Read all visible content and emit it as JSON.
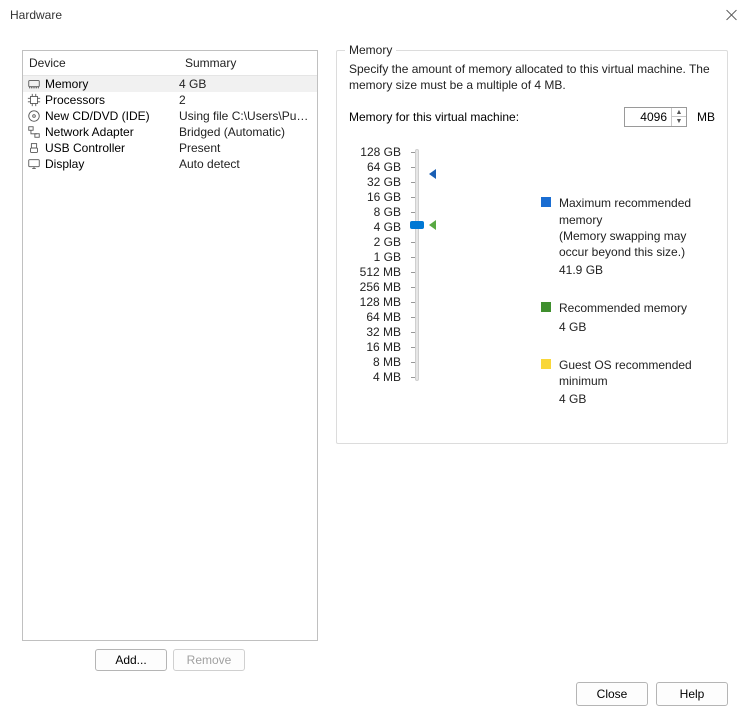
{
  "window": {
    "title": "Hardware"
  },
  "table": {
    "head_device": "Device",
    "head_summary": "Summary",
    "rows": [
      {
        "icon": "memory-icon",
        "device": "Memory",
        "summary": "4 GB",
        "selected": true
      },
      {
        "icon": "processor-icon",
        "device": "Processors",
        "summary": "2",
        "selected": false
      },
      {
        "icon": "cd-icon",
        "device": "New CD/DVD (IDE)",
        "summary": "Using file C:\\Users\\Public\\VM...",
        "selected": false
      },
      {
        "icon": "network-icon",
        "device": "Network Adapter",
        "summary": "Bridged (Automatic)",
        "selected": false
      },
      {
        "icon": "usb-icon",
        "device": "USB Controller",
        "summary": "Present",
        "selected": false
      },
      {
        "icon": "display-icon",
        "device": "Display",
        "summary": "Auto detect",
        "selected": false
      }
    ]
  },
  "buttons": {
    "add": "Add...",
    "remove": "Remove",
    "close": "Close",
    "help": "Help"
  },
  "memory": {
    "legend": "Memory",
    "description": "Specify the amount of memory allocated to this virtual machine. The memory size must be a multiple of 4 MB.",
    "field_label": "Memory for this virtual machine:",
    "value": "4096",
    "unit": "MB",
    "ticks": [
      "128 GB",
      "64 GB",
      "32 GB",
      "16 GB",
      "8 GB",
      "4 GB",
      "2 GB",
      "1 GB",
      "512 MB",
      "256 MB",
      "128 MB",
      "64 MB",
      "32 MB",
      "16 MB",
      "8 MB",
      "4 MB"
    ],
    "legend_items": {
      "max": {
        "title": "Maximum recommended memory",
        "sub": "(Memory swapping may occur beyond this size.)",
        "val": "41.9 GB"
      },
      "rec": {
        "title": "Recommended memory",
        "val": "4 GB"
      },
      "min": {
        "title": "Guest OS recommended minimum",
        "val": "4 GB"
      }
    }
  }
}
